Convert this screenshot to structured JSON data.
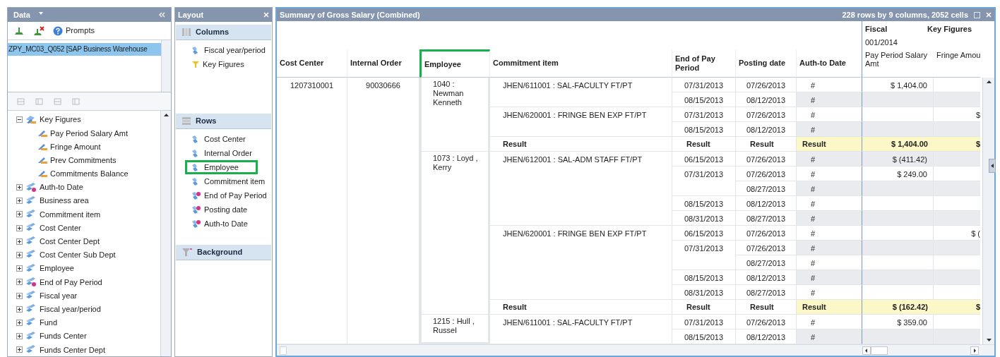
{
  "data_panel": {
    "title": "Data",
    "prompts_button": "Prompts",
    "sources": [
      {
        "label": "ZPY_MC03_Q052 [SAP Business Warehouse",
        "selected": true
      }
    ],
    "tree": [
      {
        "label": "Key Figures",
        "kind": "key_figures",
        "expanded": true,
        "children": [
          {
            "label": "Pay Period Salary Amt",
            "kind": "key_figure"
          },
          {
            "label": "Fringe Amount",
            "kind": "key_figure"
          },
          {
            "label": "Prev Commitments",
            "kind": "key_figure"
          },
          {
            "label": "Commitments Balance",
            "kind": "key_figure"
          }
        ]
      },
      {
        "label": "Auth-to Date",
        "kind": "date",
        "expanded": false
      },
      {
        "label": "Business area",
        "kind": "characteristic",
        "expanded": false
      },
      {
        "label": "Commitment item",
        "kind": "characteristic",
        "expanded": false
      },
      {
        "label": "Cost Center",
        "kind": "characteristic",
        "expanded": false
      },
      {
        "label": "Cost Center Dept",
        "kind": "characteristic",
        "expanded": false
      },
      {
        "label": "Cost Center Sub Dept",
        "kind": "characteristic",
        "expanded": false
      },
      {
        "label": "Employee",
        "kind": "characteristic",
        "expanded": false
      },
      {
        "label": "End of Pay Period",
        "kind": "date",
        "expanded": false
      },
      {
        "label": "Fiscal year",
        "kind": "characteristic",
        "expanded": false
      },
      {
        "label": "Fiscal year/period",
        "kind": "characteristic",
        "expanded": false
      },
      {
        "label": "Fund",
        "kind": "characteristic",
        "expanded": false
      },
      {
        "label": "Funds Center",
        "kind": "characteristic",
        "expanded": false
      },
      {
        "label": "Funds Center Dept",
        "kind": "characteristic",
        "expanded": false
      }
    ]
  },
  "layout_panel": {
    "title": "Layout",
    "sections": [
      {
        "title": "Columns",
        "kind": "columns",
        "items": [
          {
            "label": "Fiscal year/period",
            "kind": "characteristic",
            "highlighted": false
          },
          {
            "label": "Key Figures",
            "kind": "key_figures",
            "highlighted": false
          }
        ]
      },
      {
        "title": "Rows",
        "kind": "rows",
        "items": [
          {
            "label": "Cost Center",
            "kind": "characteristic",
            "highlighted": false
          },
          {
            "label": "Internal Order",
            "kind": "characteristic",
            "highlighted": false
          },
          {
            "label": "Employee",
            "kind": "characteristic",
            "highlighted": true
          },
          {
            "label": "Commitment item",
            "kind": "characteristic",
            "highlighted": false
          },
          {
            "label": "End of Pay Period",
            "kind": "date",
            "highlighted": false
          },
          {
            "label": "Posting date",
            "kind": "date",
            "highlighted": false
          },
          {
            "label": "Auth-to Date",
            "kind": "date",
            "highlighted": false
          }
        ]
      },
      {
        "title": "Background",
        "kind": "background"
      }
    ]
  },
  "report": {
    "title": "Summary of Gross Salary (Combined)",
    "summary": "228 rows by 9 columns, 2052 cells",
    "key_figure_header": {
      "dimension": "Fiscal",
      "label": "Key Figures",
      "period": "001/2014"
    },
    "columns": [
      {
        "label": "Cost Center",
        "highlighted": false
      },
      {
        "label": "Internal Order",
        "highlighted": false
      },
      {
        "label": "Employee",
        "highlighted": true
      },
      {
        "label": "Commitment item",
        "highlighted": false
      },
      {
        "label": "End of Pay Period",
        "highlighted": false
      },
      {
        "label": "Posting date",
        "highlighted": false
      },
      {
        "label": "Auth-to Date",
        "highlighted": false
      },
      {
        "label": "Pay Period Salary Amt",
        "highlighted": false
      },
      {
        "label": "Fringe Amou",
        "highlighted": false
      }
    ],
    "groups": [
      {
        "cost_center": "1207310001",
        "internal_order": "90030666",
        "employees": [
          {
            "employee": "1040 : Newman Kenneth",
            "items": [
              {
                "commitment_item": "JHEN/611001 : SAL-FACULTY FT/PT",
                "periods": [
                  {
                    "end_of_pay": "07/31/2013",
                    "postings": [
                      {
                        "posting_date": "07/26/2013",
                        "auth": "#",
                        "pay": "$ 1,404.00"
                      }
                    ]
                  },
                  {
                    "end_of_pay": "08/15/2013",
                    "postings": [
                      {
                        "posting_date": "08/12/2013",
                        "auth": "#"
                      }
                    ]
                  }
                ]
              },
              {
                "commitment_item": "JHEN/620001 : FRINGE BEN EXP FT/PT",
                "periods": [
                  {
                    "end_of_pay": "07/31/2013",
                    "postings": [
                      {
                        "posting_date": "07/26/2013",
                        "auth": "#",
                        "fringe": "$"
                      }
                    ]
                  },
                  {
                    "end_of_pay": "08/15/2013",
                    "postings": [
                      {
                        "posting_date": "08/12/2013",
                        "auth": "#"
                      }
                    ]
                  }
                ]
              }
            ],
            "result": {
              "labels": [
                "Result",
                "Result",
                "Result",
                "Result"
              ],
              "pay": "$ 1,404.00",
              "fringe": "$"
            }
          },
          {
            "employee": "1073 : Loyd , Kerry",
            "items": [
              {
                "commitment_item": "JHEN/612001 : SAL-ADM STAFF FT/PT",
                "periods": [
                  {
                    "end_of_pay": "06/15/2013",
                    "postings": [
                      {
                        "posting_date": "07/26/2013",
                        "auth": "#",
                        "pay": "$ (411.42)"
                      }
                    ]
                  },
                  {
                    "end_of_pay": "07/31/2013",
                    "postings": [
                      {
                        "posting_date": "07/26/2013",
                        "auth": "#",
                        "pay": "$ 249.00"
                      },
                      {
                        "posting_date": "08/27/2013",
                        "auth": "#"
                      }
                    ]
                  },
                  {
                    "end_of_pay": "08/15/2013",
                    "postings": [
                      {
                        "posting_date": "08/12/2013",
                        "auth": "#"
                      }
                    ]
                  },
                  {
                    "end_of_pay": "08/31/2013",
                    "postings": [
                      {
                        "posting_date": "08/27/2013",
                        "auth": "#"
                      }
                    ]
                  }
                ]
              },
              {
                "commitment_item": "JHEN/620001 : FRINGE BEN EXP FT/PT",
                "periods": [
                  {
                    "end_of_pay": "06/15/2013",
                    "postings": [
                      {
                        "posting_date": "07/26/2013",
                        "auth": "#",
                        "fringe": "$ ("
                      }
                    ]
                  },
                  {
                    "end_of_pay": "07/31/2013",
                    "postings": [
                      {
                        "posting_date": "07/26/2013",
                        "auth": "#"
                      },
                      {
                        "posting_date": "08/27/2013",
                        "auth": "#"
                      }
                    ]
                  },
                  {
                    "end_of_pay": "08/15/2013",
                    "postings": [
                      {
                        "posting_date": "08/12/2013",
                        "auth": "#"
                      }
                    ]
                  },
                  {
                    "end_of_pay": "08/31/2013",
                    "postings": [
                      {
                        "posting_date": "08/27/2013",
                        "auth": "#"
                      }
                    ]
                  }
                ]
              }
            ],
            "result": {
              "labels": [
                "Result",
                "Result",
                "Result",
                "Result"
              ],
              "pay": "$ (162.42)",
              "fringe": "$"
            }
          },
          {
            "employee": "1215 : Hull , Russel",
            "items": [
              {
                "commitment_item": "JHEN/611001 : SAL-FACULTY FT/PT",
                "periods": [
                  {
                    "end_of_pay": "07/31/2013",
                    "postings": [
                      {
                        "posting_date": "07/26/2013",
                        "auth": "#",
                        "pay": "$ 359.00"
                      }
                    ]
                  },
                  {
                    "end_of_pay": "08/15/2013",
                    "postings": [
                      {
                        "posting_date": "08/12/2013",
                        "auth": "#"
                      }
                    ]
                  }
                ]
              }
            ]
          }
        ]
      }
    ]
  }
}
